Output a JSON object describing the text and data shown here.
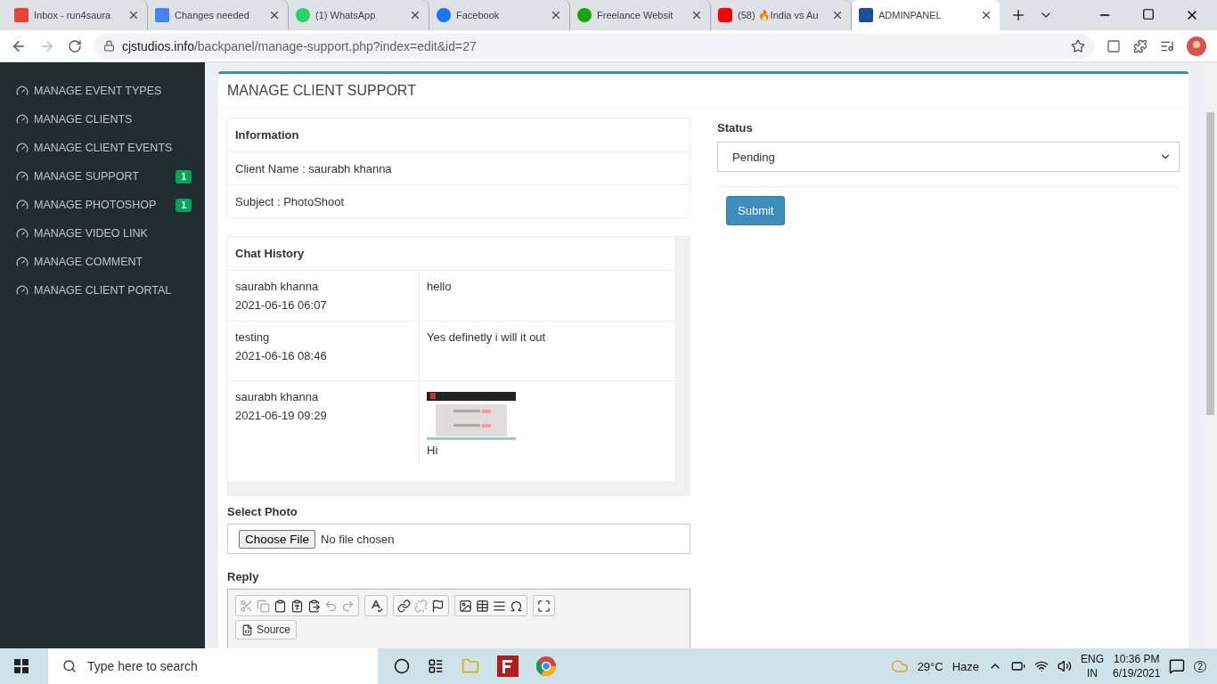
{
  "browser": {
    "tabs": [
      {
        "title": "Inbox - run4saura",
        "selected": false
      },
      {
        "title": "Changes needed",
        "selected": false
      },
      {
        "title": "(1) WhatsApp",
        "selected": false
      },
      {
        "title": "Facebook",
        "selected": false
      },
      {
        "title": "Freelance Websit",
        "selected": false
      },
      {
        "title": "(58) 🔥India vs Au",
        "selected": false
      },
      {
        "title": "ADMINPANEL",
        "selected": true
      }
    ],
    "url_host": "cjstudios.info",
    "url_path": "/backpanel/manage-support.php?index=edit&id=27"
  },
  "sidebar": {
    "items": [
      {
        "label": "MANAGE EVENT TYPES"
      },
      {
        "label": "MANAGE CLIENTS"
      },
      {
        "label": "MANAGE CLIENT EVENTS"
      },
      {
        "label": "MANAGE SUPPORT",
        "badge": "1"
      },
      {
        "label": "MANAGE PHOTOSHOP",
        "badge": "1"
      },
      {
        "label": "MANAGE VIDEO LINK"
      },
      {
        "label": "MANAGE COMMENT"
      },
      {
        "label": "MANAGE CLIENT PORTAL"
      }
    ]
  },
  "panel": {
    "title": "MANAGE CLIENT SUPPORT",
    "info": {
      "heading": "Information",
      "rows": [
        "Client Name : saurabh khanna",
        "Subject : PhotoShoot"
      ]
    },
    "chat": {
      "heading": "Chat History",
      "rows": [
        {
          "sender": "saurabh khanna",
          "time": "2021-06-16 06:07",
          "message": "hello"
        },
        {
          "sender": "testing",
          "time": "2021-06-16 08:46",
          "message": "Yes definetly i will it out"
        },
        {
          "sender": "saurabh khanna",
          "time": "2021-06-19 09:29",
          "message": "Hi"
        }
      ]
    },
    "photo": {
      "label": "Select Photo",
      "button": "Choose File",
      "status": "No file chosen"
    },
    "reply": {
      "label": "Reply",
      "source_button": "Source"
    },
    "status": {
      "label": "Status",
      "value": "Pending"
    },
    "submit": "Submit"
  },
  "taskbar": {
    "search_placeholder": "Type here to search",
    "temperature": "29°C",
    "weather": "Haze",
    "lang": "ENG",
    "region": "IN",
    "time": "10:36 PM",
    "date": "6/19/2021",
    "notifications": "2"
  }
}
